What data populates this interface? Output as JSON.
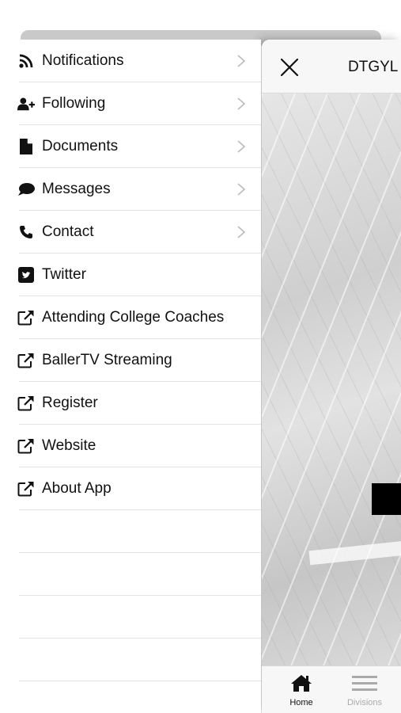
{
  "header": {
    "title": "DTGYL"
  },
  "menu": {
    "items": [
      {
        "label": "Notifications",
        "icon": "rss-icon",
        "chevron": true
      },
      {
        "label": "Following",
        "icon": "user-plus-icon",
        "chevron": true
      },
      {
        "label": "Documents",
        "icon": "document-icon",
        "chevron": true
      },
      {
        "label": "Messages",
        "icon": "chat-bubble-icon",
        "chevron": true
      },
      {
        "label": "Contact",
        "icon": "phone-icon",
        "chevron": true
      },
      {
        "label": "Twitter",
        "icon": "twitter-square-icon",
        "chevron": false
      },
      {
        "label": "Attending College Coaches",
        "icon": "external-link-icon",
        "chevron": false
      },
      {
        "label": "BallerTV Streaming",
        "icon": "external-link-icon",
        "chevron": false
      },
      {
        "label": "Register",
        "icon": "external-link-icon",
        "chevron": false
      },
      {
        "label": "Website",
        "icon": "external-link-icon",
        "chevron": false
      },
      {
        "label": "About App",
        "icon": "external-link-icon",
        "chevron": false
      }
    ]
  },
  "tabbar": {
    "tabs": [
      {
        "label": "Home",
        "icon": "home-icon",
        "active": true
      },
      {
        "label": "Divisions",
        "icon": "menu-lines-icon",
        "active": false
      }
    ]
  },
  "colors": {
    "text": "#111111",
    "divider": "#e3e3e3",
    "inactive_tab": "#aaaaaa"
  }
}
